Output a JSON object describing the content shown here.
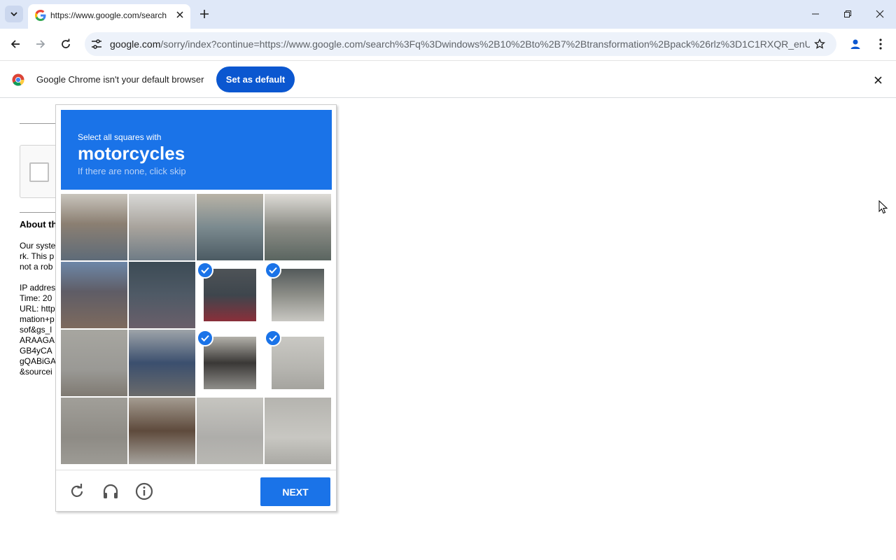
{
  "browser": {
    "tab_title": "https://www.google.com/search",
    "url_host": "google.com",
    "url_rest": "/sorry/index?continue=https://www.google.com/search%3Fq%3Dwindows%2B10%2Bto%2B7%2Btransformation%2Bpack%26rlz%3D1C1RXQR_enU...",
    "icons": {
      "tab_search": "chevron-down-icon",
      "favicon": "google-g-icon",
      "close_tab": "close-icon",
      "new_tab": "plus-icon",
      "minimize": "minimize-icon",
      "restore": "restore-icon",
      "close_window": "close-icon",
      "back": "back-arrow-icon",
      "forward": "forward-arrow-icon",
      "reload": "reload-icon",
      "site_info": "tune-icon",
      "bookmark": "star-icon",
      "profile": "profile-icon",
      "menu": "kebab-menu-icon"
    }
  },
  "infobar": {
    "message": "Google Chrome isn't your default browser",
    "button_label": "Set as default"
  },
  "page": {
    "about_heading": "About th",
    "lines": [
      "Our syste",
      "rk. This p",
      "not a rob",
      "",
      "IP addres",
      "Time: 20",
      "URL: http",
      "mation+p",
      "sof&gs_l",
      "ARAAGA",
      "GB4yCA",
      "gQABiGA",
      "&sourcei"
    ]
  },
  "captcha": {
    "instruction": "Select all squares with",
    "target": "motorcycles",
    "skip_hint": "If there are none, click skip",
    "next_label": "NEXT",
    "selected_tiles": [
      6,
      7,
      10,
      11
    ],
    "accent": "#1a73e8",
    "footer_icons": [
      "reload-icon",
      "headphones-icon",
      "info-icon"
    ]
  }
}
